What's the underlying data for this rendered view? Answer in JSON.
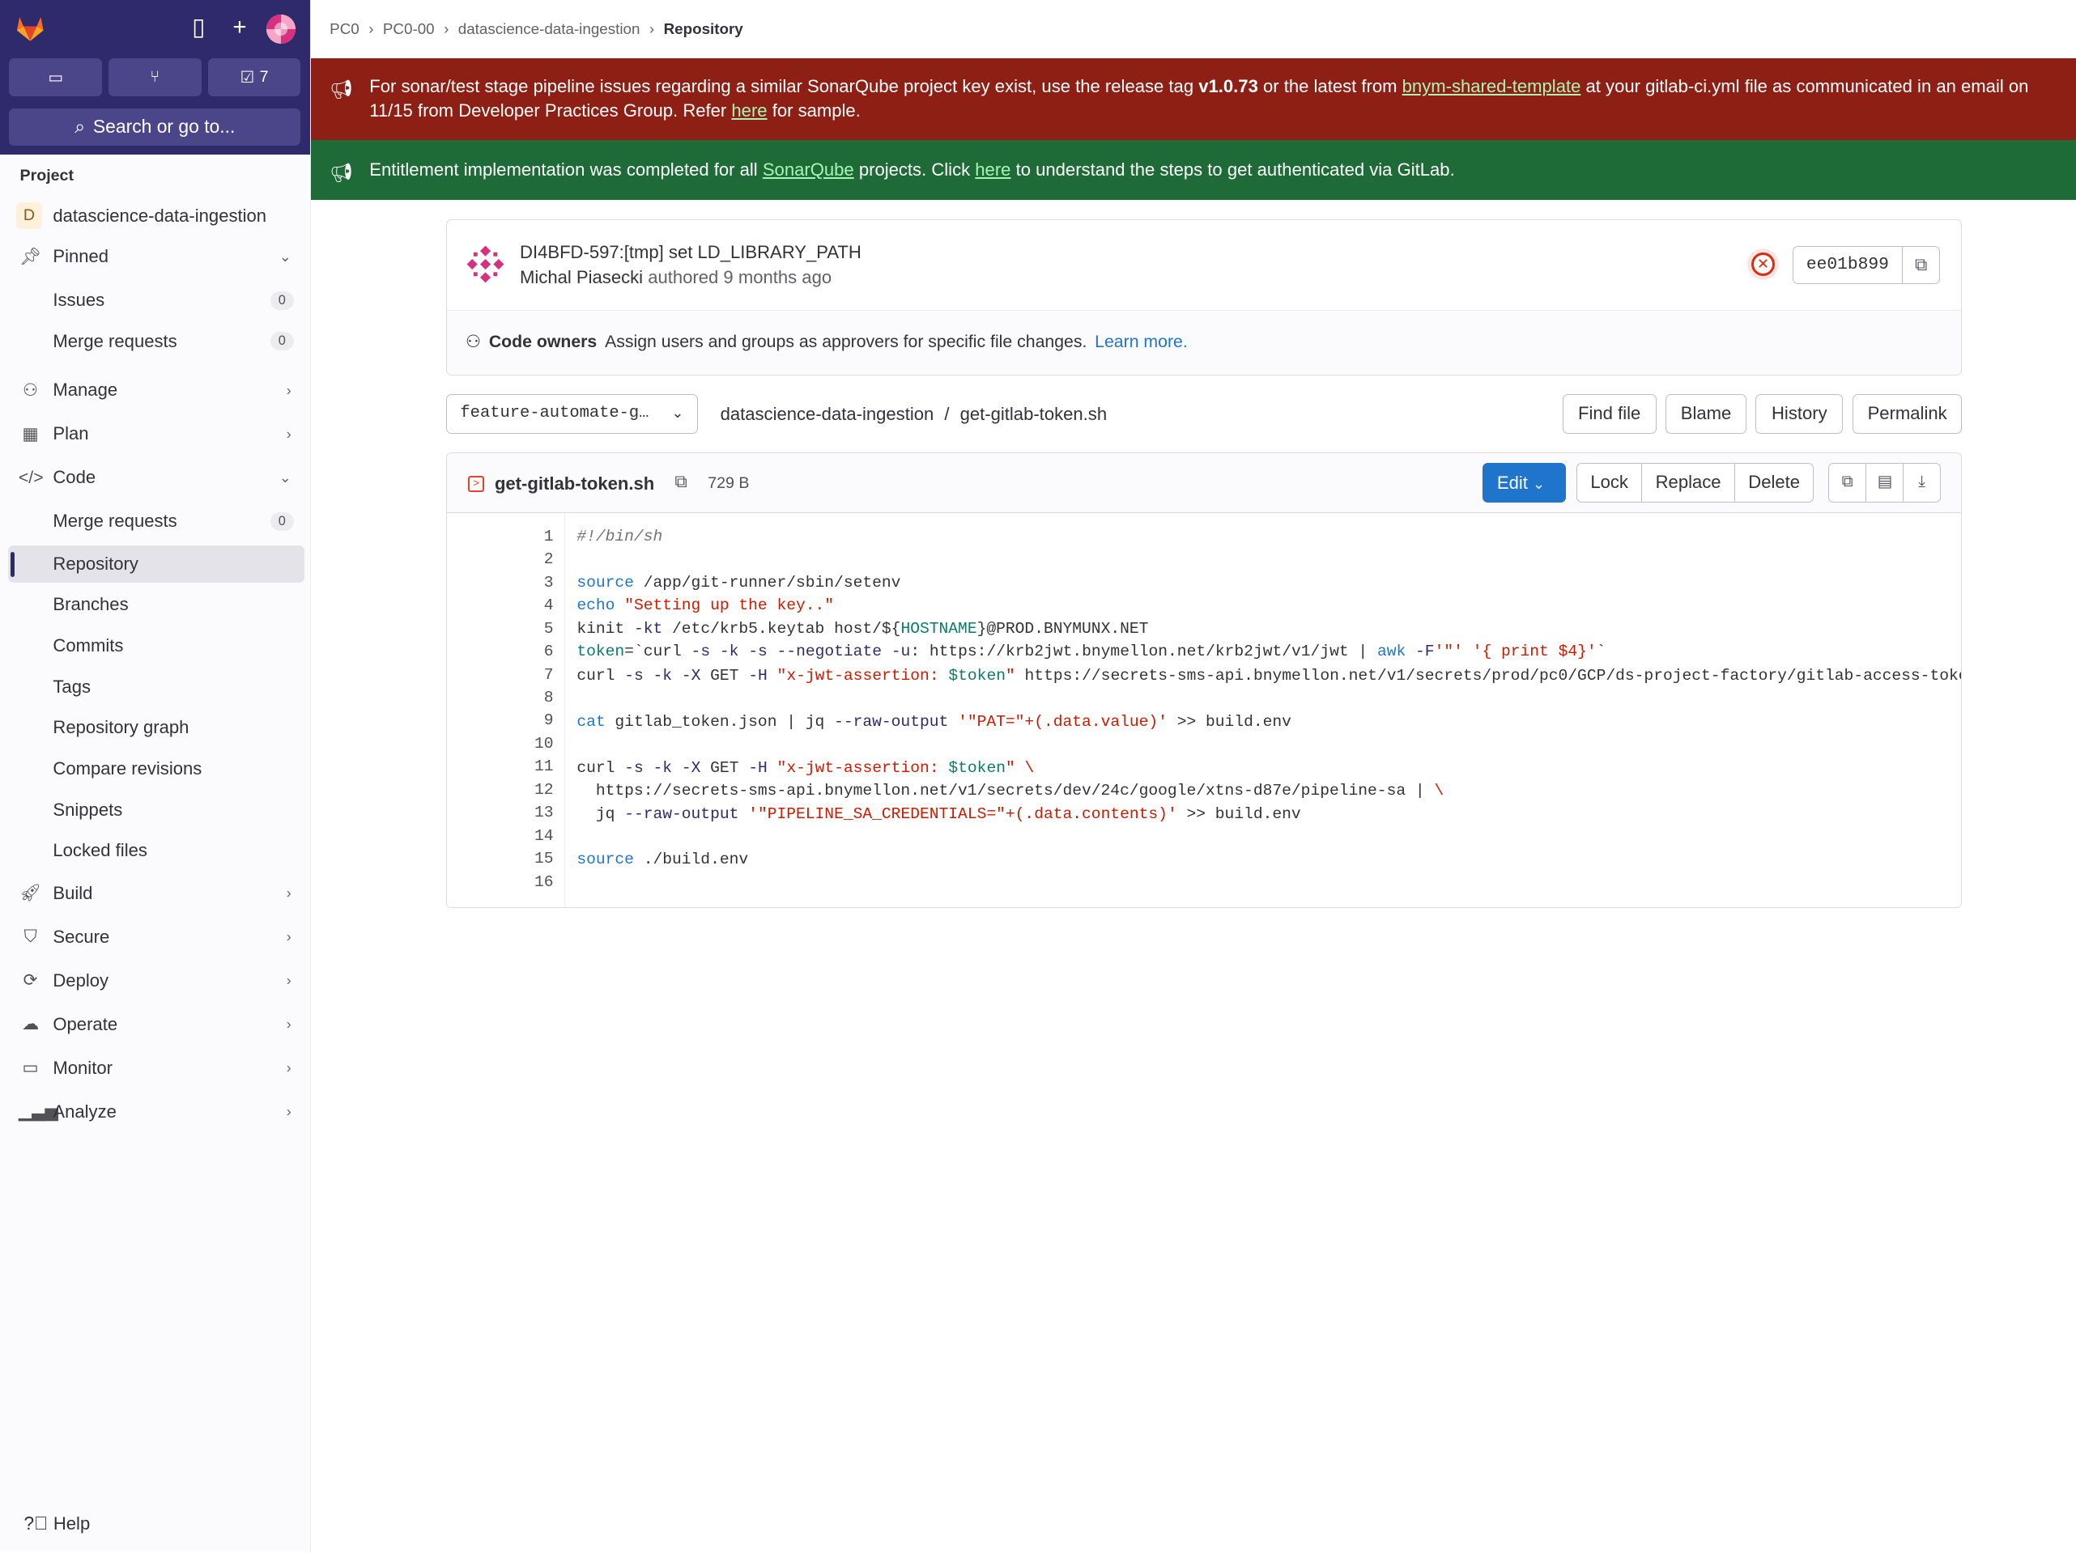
{
  "sidebar": {
    "counts": {
      "issues_icon": "issues-icon",
      "mr_icon": "merge-request-icon",
      "todo_count": "7"
    },
    "search_placeholder": "Search or go to...",
    "section_label": "Project",
    "project_initial": "D",
    "project_name": "datascience-data-ingestion",
    "pinned": "Pinned",
    "issues": "Issues",
    "issues_count": "0",
    "merge_requests": "Merge requests",
    "mr_count": "0",
    "manage": "Manage",
    "plan": "Plan",
    "code": "Code",
    "code_items": [
      "Merge requests",
      "Repository",
      "Branches",
      "Commits",
      "Tags",
      "Repository graph",
      "Compare revisions",
      "Snippets",
      "Locked files"
    ],
    "code_mr_count": "0",
    "build": "Build",
    "secure": "Secure",
    "deploy": "Deploy",
    "operate": "Operate",
    "monitor": "Monitor",
    "analyze": "Analyze",
    "help": "Help"
  },
  "breadcrumbs": [
    "PC0",
    "PC0-00",
    "datascience-data-ingestion",
    "Repository"
  ],
  "banners": {
    "sonar": {
      "p1": "For sonar/test stage pipeline issues regarding a similar SonarQube project key exist, use the release tag ",
      "tag": "v1.0.73",
      "p2": " or the latest from ",
      "link": "bnym-shared-template",
      "p3": " at your gitlab-ci.yml file as communicated in an email on 11/15 from Developer Practices Group. Refer ",
      "here": "here",
      "p4": " for sample."
    },
    "entitlement": {
      "p1": "Entitlement implementation was completed for all ",
      "link": "SonarQube",
      "p2": " projects. Click ",
      "here": "here",
      "p3": " to understand the steps to get authenticated via GitLab."
    }
  },
  "commit": {
    "title": "DI4BFD-597:[tmp] set LD_LIBRARY_PATH",
    "author": "Michal Piasecki",
    "meta": " authored 9 months ago",
    "status": "failed",
    "sha": "ee01b899",
    "code_owners_label": "Code owners",
    "code_owners_text": "Assign users and groups as approvers for specific file changes.",
    "learn_more": "Learn more."
  },
  "toolbar": {
    "branch": "feature-automate-g…",
    "path_repo": "datascience-data-ingestion",
    "path_sep": "/",
    "path_file": "get-gitlab-token.sh",
    "find_file": "Find file",
    "blame": "Blame",
    "history": "History",
    "permalink": "Permalink"
  },
  "file": {
    "name": "get-gitlab-token.sh",
    "size": "729 B",
    "edit": "Edit",
    "lock": "Lock",
    "replace": "Replace",
    "delete": "Delete",
    "line_numbers": [
      "1",
      "2",
      "3",
      "4",
      "5",
      "6",
      "7",
      "8",
      "9",
      "10",
      "11",
      "12",
      "13",
      "14",
      "15",
      "16"
    ]
  },
  "colors": {
    "sidebar_top": "#2f2a6b",
    "banner_red": "#8d1f14",
    "banner_green": "#1e6b37",
    "primary": "#1f75cb"
  }
}
